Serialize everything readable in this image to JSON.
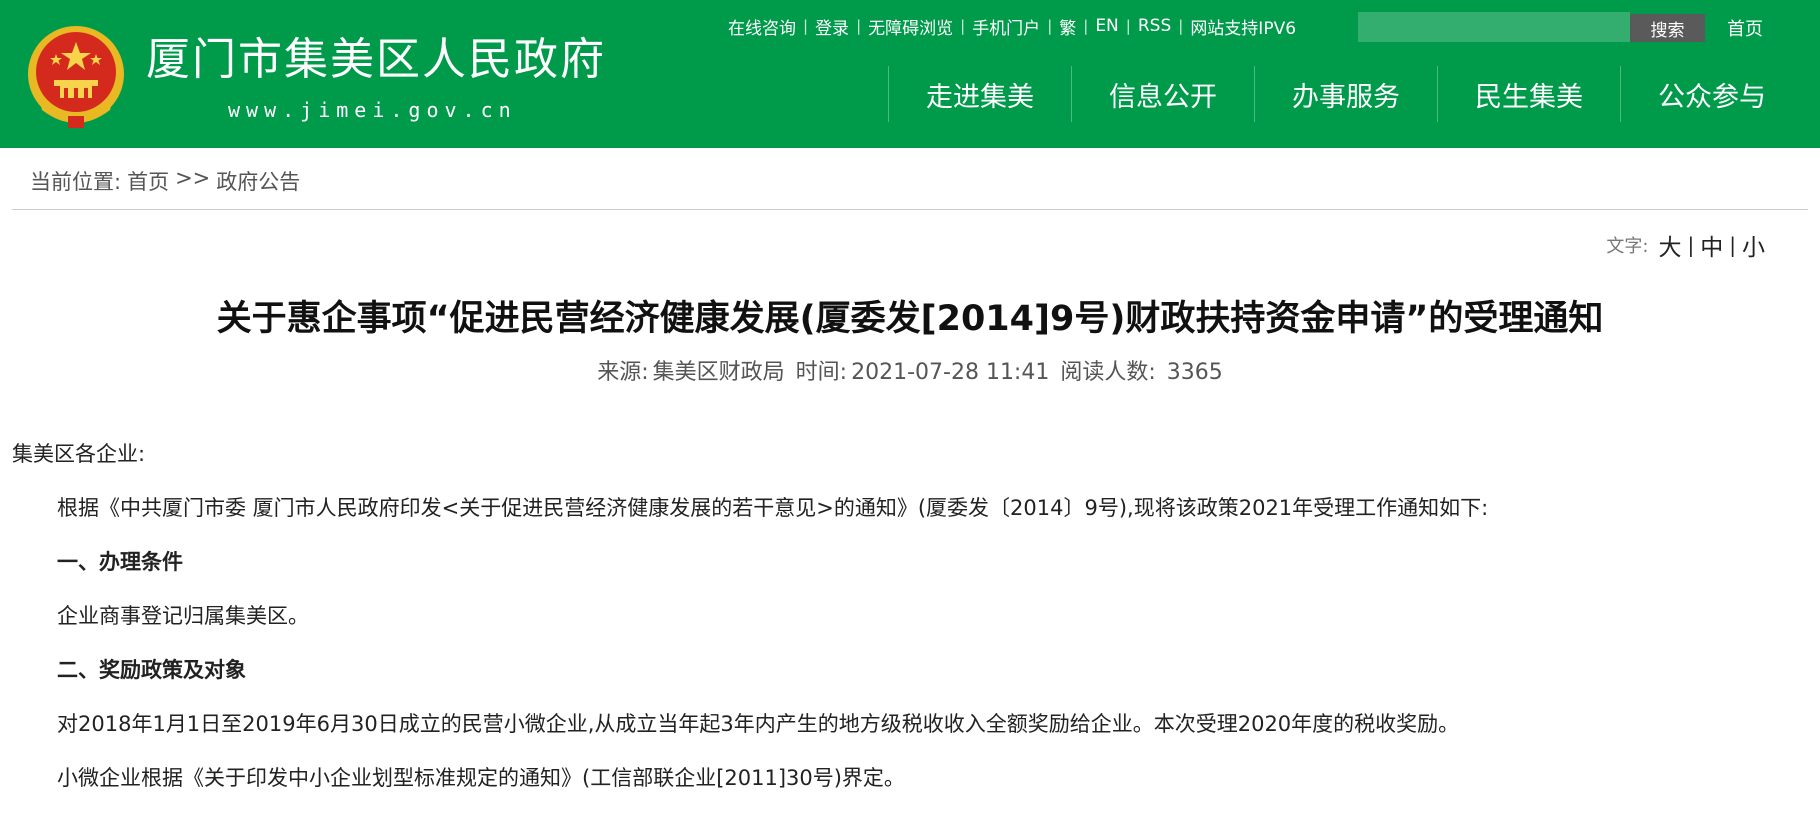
{
  "header": {
    "site_title": "厦门市集美区人民政府",
    "site_url": "www.jimei.gov.cn",
    "brand_color": "#009a4b",
    "top_links": [
      "在线咨询",
      "登录",
      "无障碍浏览",
      "手机门户",
      "繁",
      "EN",
      "RSS",
      "网站支持IPV6"
    ],
    "search": {
      "placeholder": "",
      "button_label": "搜索"
    },
    "home_label": "首页",
    "nav": [
      "走进集美",
      "信息公开",
      "办事服务",
      "民生集美",
      "公众参与"
    ]
  },
  "breadcrumb": {
    "prefix": "当前位置:",
    "home": "首页",
    "separator": ">>",
    "current": "政府公告"
  },
  "font_size_control": {
    "label": "文字:",
    "options": [
      "大",
      "中",
      "小"
    ]
  },
  "article": {
    "title": "关于惠企事项“促进民营经济健康发展(厦委发[2014]9号)财政扶持资金申请”的受理通知",
    "meta": {
      "source_label": "来源:",
      "source": "集美区财政局",
      "time_label": "时间:",
      "time": "2021-07-28 11:41",
      "views_label": "阅读人数:",
      "views": "3365"
    },
    "paragraphs": [
      "集美区各企业:",
      "根据《中共厦门市委 厦门市人民政府印发<关于促进民营经济健康发展的若干意见>的通知》(厦委发〔2014〕9号),现将该政策2021年受理工作通知如下:",
      "一、办理条件",
      "企业商事登记归属集美区。",
      "二、奖励政策及对象",
      "对2018年1月1日至2019年6月30日成立的民营小微企业,从成立当年起3年内产生的地方级税收收入全额奖励给企业。本次受理2020年度的税收奖励。",
      "小微企业根据《关于印发中小企业划型标准规定的通知》(工信部联企业[2011]30号)界定。"
    ]
  }
}
